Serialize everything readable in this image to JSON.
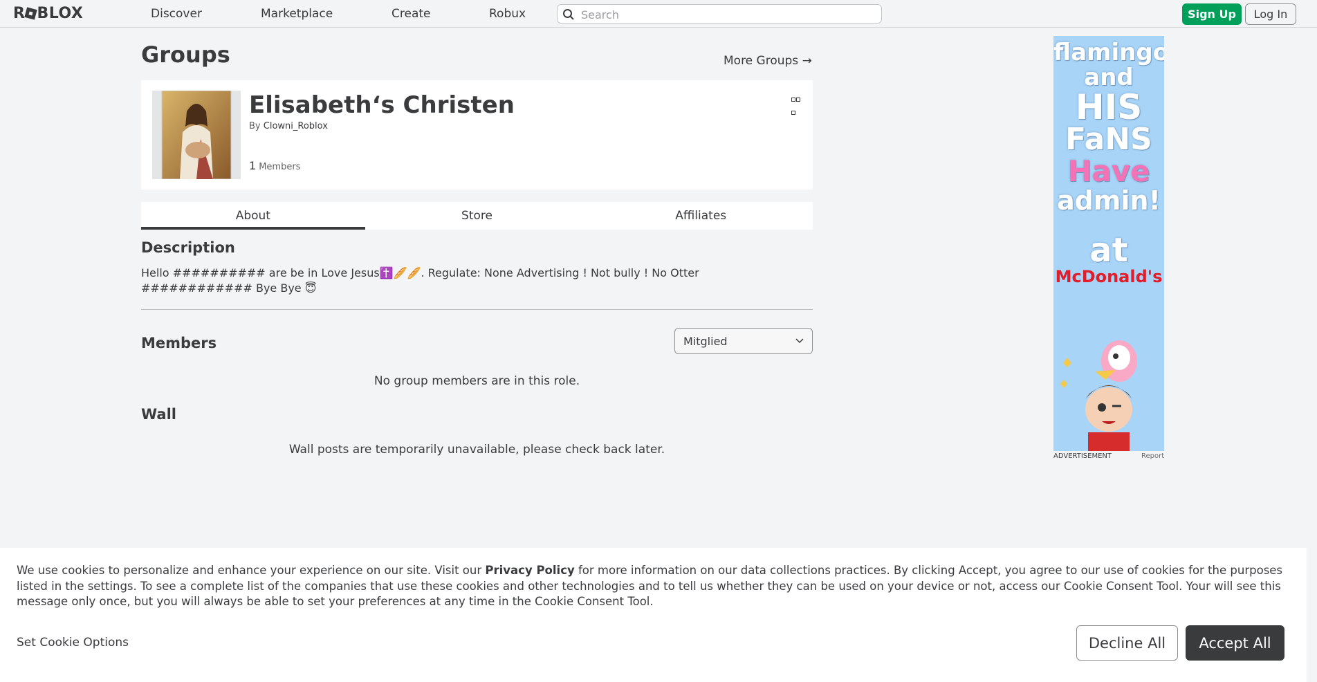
{
  "header": {
    "logo": "ROBLOX",
    "nav": [
      "Discover",
      "Marketplace",
      "Create",
      "Robux"
    ],
    "search_placeholder": "Search",
    "sign_up": "Sign Up",
    "log_in": "Log In"
  },
  "page": {
    "title": "Groups",
    "more_groups": "More Groups →"
  },
  "group": {
    "name": "Elisabeth‘s Christen",
    "by_label": "By",
    "owner": "Clowni_Roblox",
    "member_count": "1",
    "members_label": "Members"
  },
  "tabs": [
    "About",
    "Store",
    "Affiliates"
  ],
  "about": {
    "description_heading": "Description",
    "description_line1": "Hello ########## are be in Love Jesus✝️🥖🥖. Regulate: None Advertising ! Not bully ! No Otter",
    "description_line2": "############ Bye Bye 😇",
    "members_heading": "Members",
    "role_selected": "Mitglied",
    "no_members": "No group members are in this role.",
    "wall_heading": "Wall",
    "wall_unavailable": "Wall posts are temporarily unavailable, please check back later."
  },
  "ad": {
    "lines": [
      "flamingo",
      "and",
      "HIS",
      "FaNS",
      "Have",
      "admin!",
      "at",
      "McDonald's"
    ],
    "label": "ADVERTISEMENT",
    "report": "Report"
  },
  "cookie": {
    "text_before_link": "We use cookies to personalize and enhance your experience on our site. Visit our ",
    "link": "Privacy Policy",
    "text_after_link": " for more information on our data collections practices. By clicking Accept, you agree to our use of cookies for the purposes listed in the settings. To see a complete list of the companies that use these cookies and other technologies and to tell us whether they can be used on your device or not, access our Cookie Consent Tool. Your will see this message only once, but you will always be able to set your preferences at any time in the Cookie Consent Tool.",
    "set_options": "Set Cookie Options",
    "decline": "Decline All",
    "accept": "Accept All"
  },
  "colors": {
    "background": "#f2f4f5",
    "signup_green": "#00a05a",
    "dark": "#393b3d",
    "ad_blue": "#a8d4f7",
    "ad_pink": "#f472b6",
    "ad_red": "#e11d2a"
  }
}
